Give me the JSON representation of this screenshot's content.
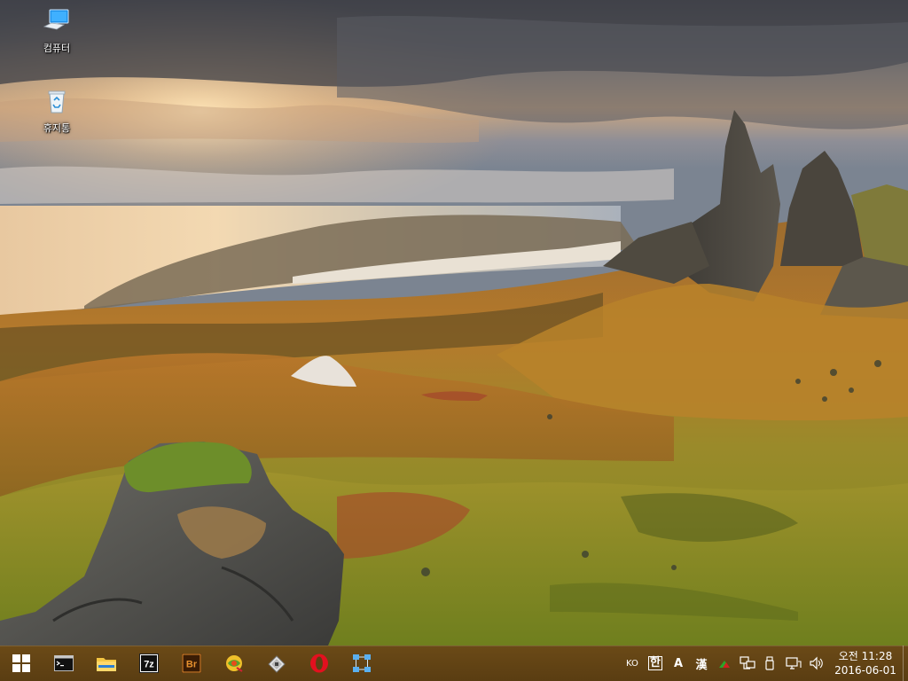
{
  "desktop": {
    "icons": [
      {
        "label": "컴퓨터",
        "icon": "computer-icon"
      },
      {
        "label": "휴지통",
        "icon": "recycle-bin-icon"
      }
    ]
  },
  "taskbar": {
    "start_icon": "windows-start-icon",
    "pinned": [
      {
        "icon": "command-prompt-icon"
      },
      {
        "icon": "file-explorer-icon"
      },
      {
        "icon": "7zip-icon",
        "text": "7z"
      },
      {
        "icon": "adobe-bridge-icon",
        "text": "Br"
      },
      {
        "icon": "network-tool-icon"
      },
      {
        "icon": "disk-tool-icon"
      },
      {
        "icon": "opera-browser-icon"
      },
      {
        "icon": "remote-connection-icon"
      }
    ],
    "tray": {
      "lang": "KO",
      "ime_hangul": "한",
      "ime_width": "A",
      "ime_hanja": "漢",
      "icons": [
        "show-hidden-icons-chevron-icon",
        "network-icon",
        "usb-device-icon",
        "monitor-network-icon",
        "volume-icon"
      ],
      "time": "오전 11:28",
      "date": "2016-06-01"
    }
  },
  "colors": {
    "taskbar": "#5e4014",
    "opera_red": "#e3101f"
  }
}
